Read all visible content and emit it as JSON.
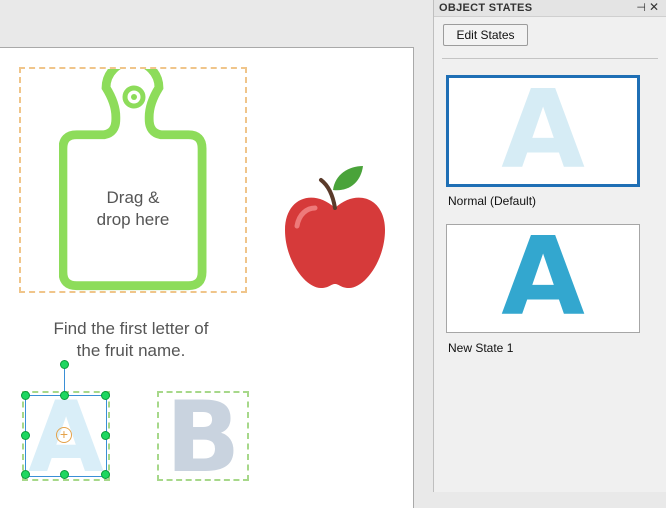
{
  "canvas": {
    "drop_zone_label_line1": "Drag &",
    "drop_zone_label_line2": "drop here",
    "instruction_line1": "Find the first letter of",
    "instruction_line2": "the fruit name.",
    "card_a_letter": "A",
    "card_b_letter": "B",
    "apple_icon": "apple-icon",
    "board_icon": "cutting-board-icon"
  },
  "panel": {
    "title": "OBJECT STATES",
    "pin_glyph": "⊣",
    "close_glyph": "✕",
    "edit_states_label": "Edit States",
    "states": [
      {
        "letter": "A",
        "label": "Normal (Default)",
        "selected": true,
        "color": "#d6ecf5"
      },
      {
        "letter": "A",
        "label": "New State 1",
        "selected": false,
        "color": "#33a7cf"
      }
    ]
  },
  "colors": {
    "board_green": "#8ddc5a",
    "selection_blue": "#1f6fb5",
    "handle_green": "#1ed760"
  }
}
